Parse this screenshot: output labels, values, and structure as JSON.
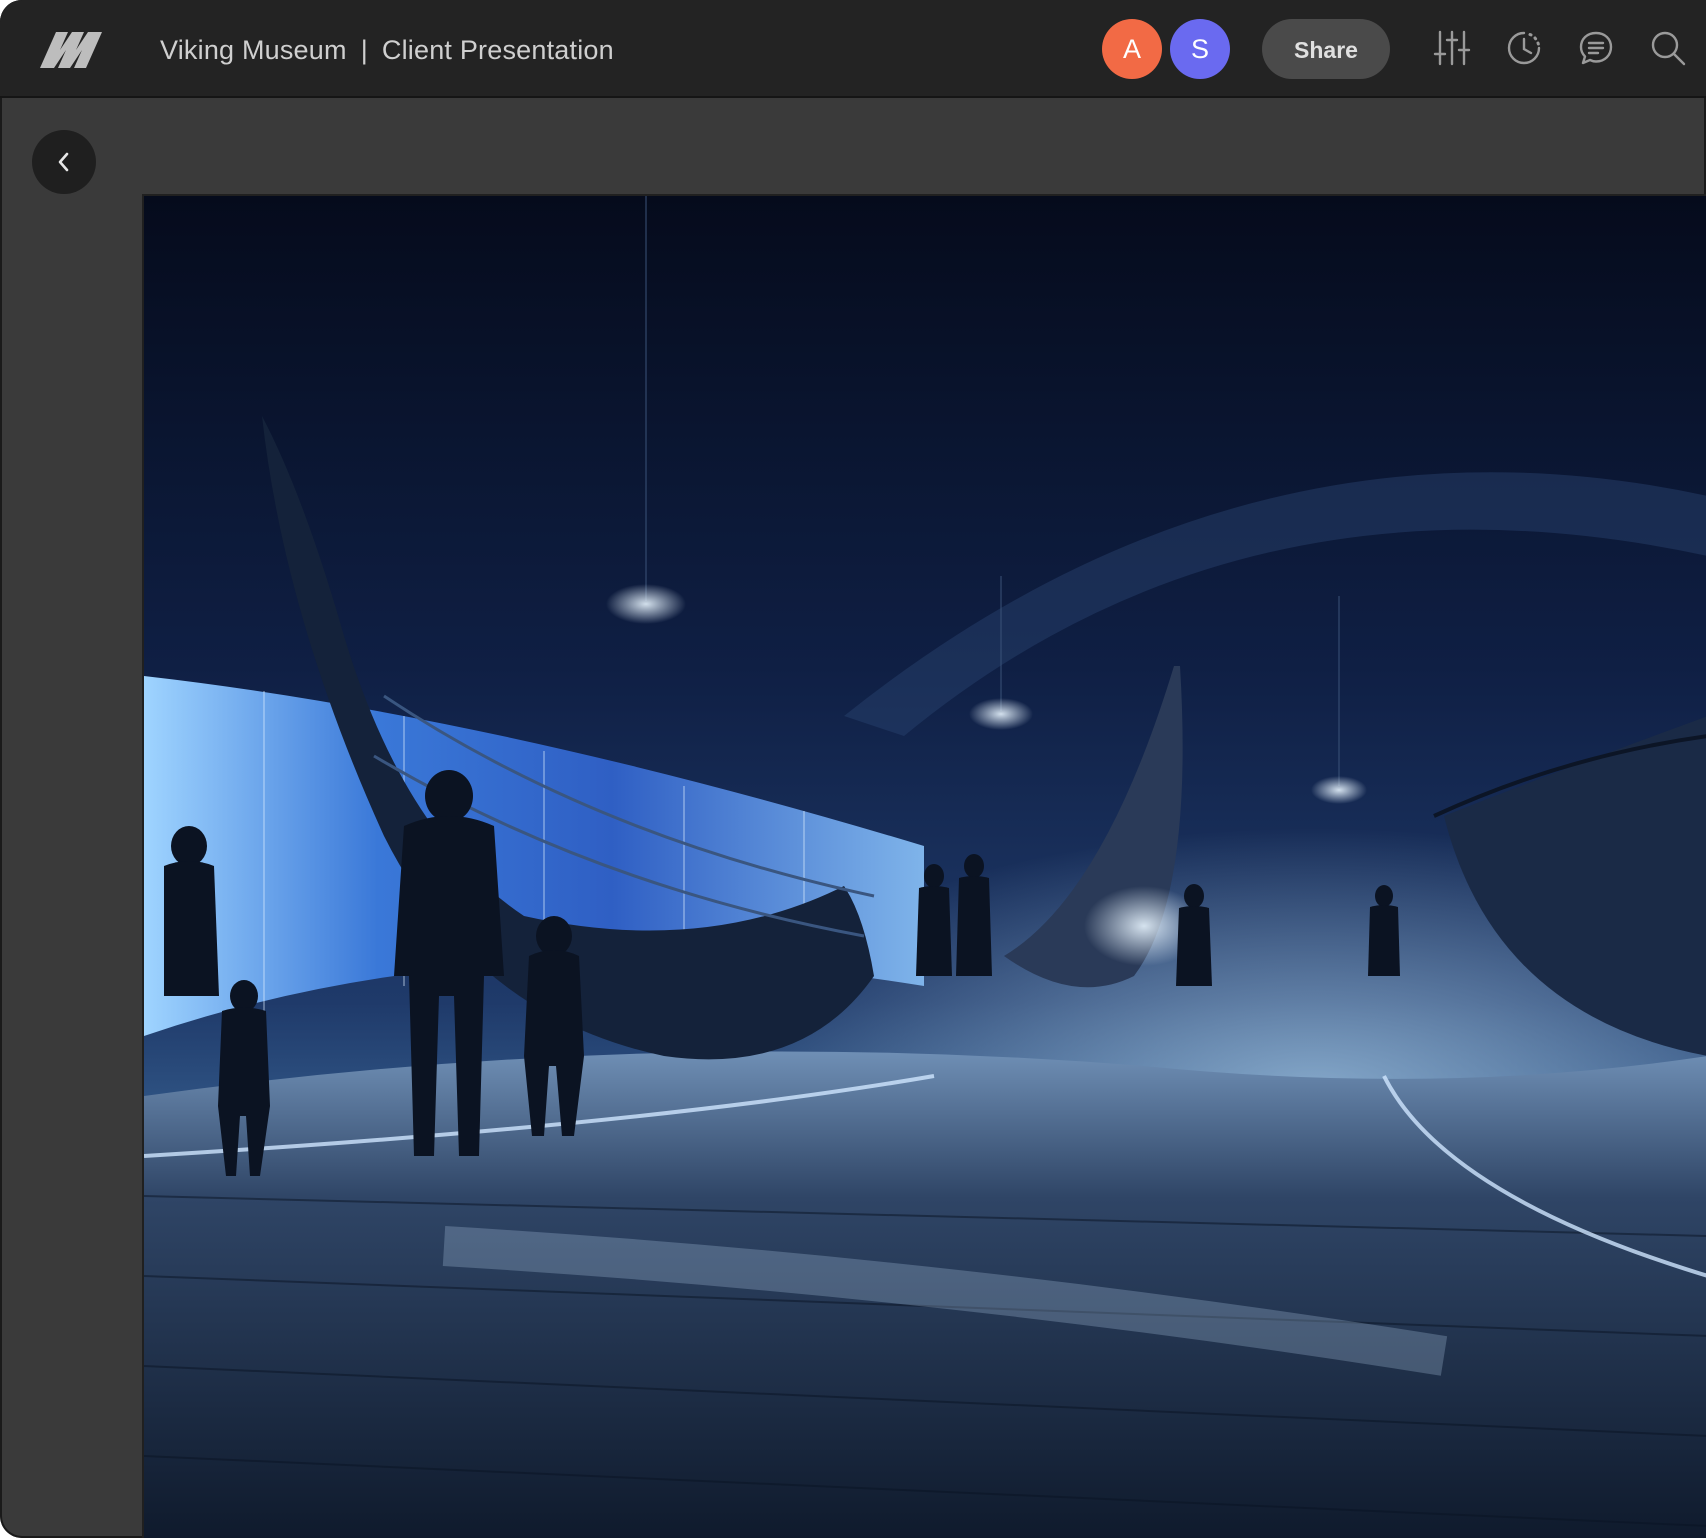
{
  "header": {
    "logo_icon": "studio-logo-icon",
    "project_name": "Viking Museum",
    "separator": "|",
    "document_name": "Client Presentation",
    "collaborators": [
      {
        "initial": "A",
        "color": "#f26a45"
      },
      {
        "initial": "S",
        "color": "#6a6af0"
      }
    ],
    "share_label": "Share",
    "tools": [
      "sliders-icon",
      "history-icon",
      "comments-icon",
      "search-icon"
    ]
  },
  "navigation": {
    "back_icon": "chevron-left-icon"
  },
  "canvas": {
    "image_subject": "viking-ship-hall-render",
    "accent_colors": [
      "#0b1630",
      "#3a78d8",
      "#9fd4ff"
    ]
  }
}
